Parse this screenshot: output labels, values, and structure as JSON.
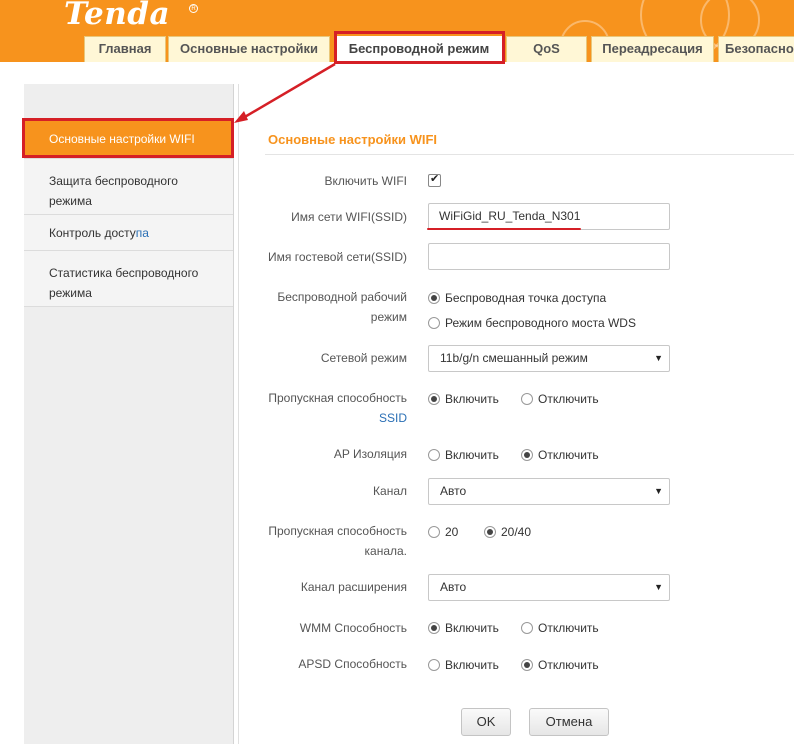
{
  "header": {
    "logo": "Tenda",
    "tabs": [
      {
        "label": "Главная"
      },
      {
        "label": "Основные настройки"
      },
      {
        "label": "Беспроводной режим",
        "active": true
      },
      {
        "label": "QoS"
      },
      {
        "label": "Переадресация"
      },
      {
        "label": "Безопасность"
      }
    ],
    "accent_color": "#f7931d",
    "highlight_color": "#d51f26"
  },
  "sidebar": {
    "items": [
      {
        "label": "Основные настройки WIFI",
        "active": true
      },
      {
        "label": "Защита беспроводного режима"
      },
      {
        "label_main": "Контроль досту",
        "label_link": "па"
      },
      {
        "label": "Статистика беспроводного режима"
      }
    ]
  },
  "main": {
    "title": "Основные настройки WIFI",
    "enable_wifi": {
      "label": "Включить WIFI",
      "checked": true
    },
    "ssid": {
      "label": "Имя сети WIFI(SSID)",
      "value": "WiFiGid_RU_Tenda_N301"
    },
    "guest_ssid": {
      "label": "Имя гостевой сети(SSID)",
      "value": ""
    },
    "wireless_mode": {
      "label_line1": "Беспроводной рабочий",
      "label_line2": "режим",
      "options": [
        "Беспроводная точка доступа",
        "Режим беспроводного моста WDS"
      ],
      "selected": 0
    },
    "network_mode": {
      "label": "Сетевой режим",
      "value": "11b/g/n смешанный режим"
    },
    "ssid_broadcast": {
      "label_line1": "Пропускная способность",
      "label_line2": "SSID",
      "options": [
        "Включить",
        "Отключить"
      ],
      "selected": 0
    },
    "ap_isolation": {
      "label": "AP Изоляция",
      "options": [
        "Включить",
        "Отключить"
      ],
      "selected": 1
    },
    "channel": {
      "label": "Канал",
      "value": "Авто"
    },
    "channel_bandwidth": {
      "label_line1": "Пропускная способность",
      "label_line2": "канала.",
      "options": [
        "20",
        "20/40"
      ],
      "selected": 1
    },
    "extension_channel": {
      "label": "Канал расширения",
      "value": "Авто"
    },
    "wmm": {
      "label": "WMM Способность",
      "options": [
        "Включить",
        "Отключить"
      ],
      "selected": 0
    },
    "apsd": {
      "label": "APSD Способность",
      "options": [
        "Включить",
        "Отключить"
      ],
      "selected": 1
    },
    "ok_label": "OK",
    "cancel_label": "Отмена"
  }
}
